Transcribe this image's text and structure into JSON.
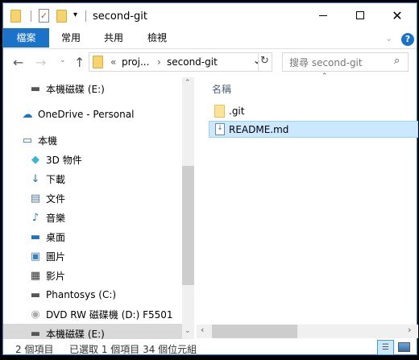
{
  "window": {
    "title": "second-git",
    "minimize_icon": "minimize-icon",
    "maximize_icon": "maximize-icon",
    "close_icon": "close-icon"
  },
  "ribbon": {
    "tabs": [
      {
        "label": "檔案"
      },
      {
        "label": "常用"
      },
      {
        "label": "共用"
      },
      {
        "label": "檢視"
      }
    ],
    "accent": "#1a73c9"
  },
  "address": {
    "overflow": "«",
    "segments": [
      "proj...",
      "second-git"
    ]
  },
  "search": {
    "placeholder": "搜尋 second-git"
  },
  "nav": {
    "items": [
      {
        "label": "本機磁碟 (E:)",
        "icon": "drive-icon"
      },
      {
        "label": "OneDrive - Personal",
        "icon": "cloud-icon"
      },
      {
        "label": "本機",
        "icon": "computer-icon"
      },
      {
        "label": "3D 物件",
        "icon": "cube-icon"
      },
      {
        "label": "下載",
        "icon": "download-icon"
      },
      {
        "label": "文件",
        "icon": "document-icon"
      },
      {
        "label": "音樂",
        "icon": "music-icon"
      },
      {
        "label": "桌面",
        "icon": "desktop-icon"
      },
      {
        "label": "圖片",
        "icon": "pictures-icon"
      },
      {
        "label": "影片",
        "icon": "video-icon"
      },
      {
        "label": "Phantosys (C:)",
        "icon": "drive-icon"
      },
      {
        "label": "DVD RW 磁碟機 (D:) F5501",
        "icon": "dvd-icon"
      },
      {
        "label": "本機磁碟 (E:)",
        "icon": "drive-icon",
        "selected": true
      }
    ]
  },
  "content": {
    "column_header": "名稱",
    "files": [
      {
        "name": ".git",
        "type": "folder"
      },
      {
        "name": "README.md",
        "type": "file",
        "selected": true
      }
    ]
  },
  "status": {
    "item_count": "2 個項目",
    "selection": "已選取 1 個項目  34 個位元組"
  }
}
